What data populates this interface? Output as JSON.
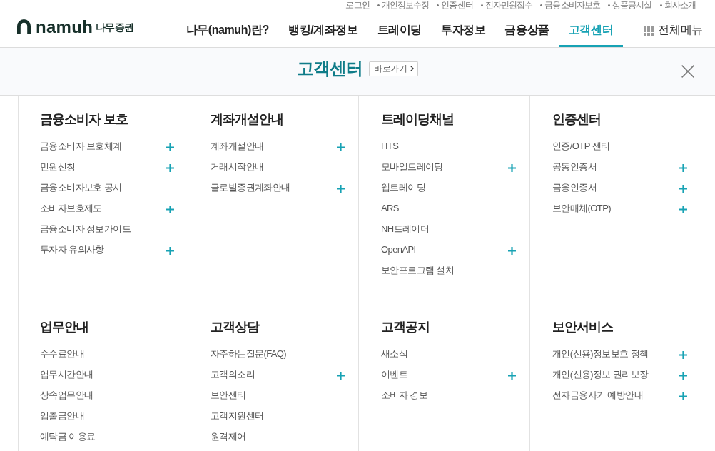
{
  "utility_links": [
    "로그인",
    "개인정보수정",
    "인증센터",
    "전자민원접수",
    "금융소비자보호",
    "상품공시실",
    "회사소개"
  ],
  "logo": {
    "wordmark": "namuh",
    "name": "나무증권"
  },
  "nav": [
    {
      "label": "나무(namuh)란?",
      "selected": false
    },
    {
      "label": "뱅킹/계좌정보",
      "selected": false
    },
    {
      "label": "트레이딩",
      "selected": false
    },
    {
      "label": "투자정보",
      "selected": false
    },
    {
      "label": "금융상품",
      "selected": false
    },
    {
      "label": "고객센터",
      "selected": true
    }
  ],
  "all_menu": {
    "label": "전체메뉴"
  },
  "banner": {
    "title": "고객센터",
    "shortcut": "바로가기"
  },
  "sections": [
    {
      "title": "금융소비자 보호",
      "items": [
        {
          "label": "금융소비자 보호체계",
          "expandable": true
        },
        {
          "label": "민원신청",
          "expandable": true
        },
        {
          "label": "금융소비자보호 공시",
          "expandable": false
        },
        {
          "label": "소비자보호제도",
          "expandable": true
        },
        {
          "label": "금융소비자 정보가이드",
          "expandable": false
        },
        {
          "label": "투자자 유의사항",
          "expandable": true
        }
      ]
    },
    {
      "title": "계좌개설안내",
      "items": [
        {
          "label": "계좌개설안내",
          "expandable": true
        },
        {
          "label": "거래시작안내",
          "expandable": false
        },
        {
          "label": "글로벌증권계좌안내",
          "expandable": true
        }
      ]
    },
    {
      "title": "트레이딩채널",
      "items": [
        {
          "label": "HTS",
          "expandable": false
        },
        {
          "label": "모바일트레이딩",
          "expandable": true
        },
        {
          "label": "웹트레이딩",
          "expandable": false
        },
        {
          "label": "ARS",
          "expandable": false
        },
        {
          "label": "NH트레이더",
          "expandable": false
        },
        {
          "label": "OpenAPI",
          "expandable": true
        },
        {
          "label": "보안프로그램 설치",
          "expandable": false
        }
      ]
    },
    {
      "title": "인증센터",
      "items": [
        {
          "label": "인증/OTP 센터",
          "expandable": false
        },
        {
          "label": "공동인증서",
          "expandable": true
        },
        {
          "label": "금융인증서",
          "expandable": true
        },
        {
          "label": "보안매체(OTP)",
          "expandable": true
        }
      ]
    },
    {
      "title": "업무안내",
      "items": [
        {
          "label": "수수료안내",
          "expandable": false
        },
        {
          "label": "업무시간안내",
          "expandable": false
        },
        {
          "label": "상속업무안내",
          "expandable": false
        },
        {
          "label": "입출금안내",
          "expandable": false
        },
        {
          "label": "예탁금 이용료",
          "expandable": false
        }
      ]
    },
    {
      "title": "고객상담",
      "items": [
        {
          "label": "자주하는질문(FAQ)",
          "expandable": false
        },
        {
          "label": "고객의소리",
          "expandable": true
        },
        {
          "label": "보안센터",
          "expandable": false
        },
        {
          "label": "고객지원센터",
          "expandable": false
        },
        {
          "label": "원격제어",
          "expandable": false
        }
      ]
    },
    {
      "title": "고객공지",
      "items": [
        {
          "label": "새소식",
          "expandable": false
        },
        {
          "label": "이벤트",
          "expandable": true
        },
        {
          "label": "소비자 경보",
          "expandable": false
        }
      ]
    },
    {
      "title": "보안서비스",
      "items": [
        {
          "label": "개인(신용)정보보호 정책",
          "expandable": true
        },
        {
          "label": "개인(신용)정보 권리보장",
          "expandable": true
        },
        {
          "label": "전자금융사기 예방안내",
          "expandable": true
        }
      ]
    }
  ]
}
